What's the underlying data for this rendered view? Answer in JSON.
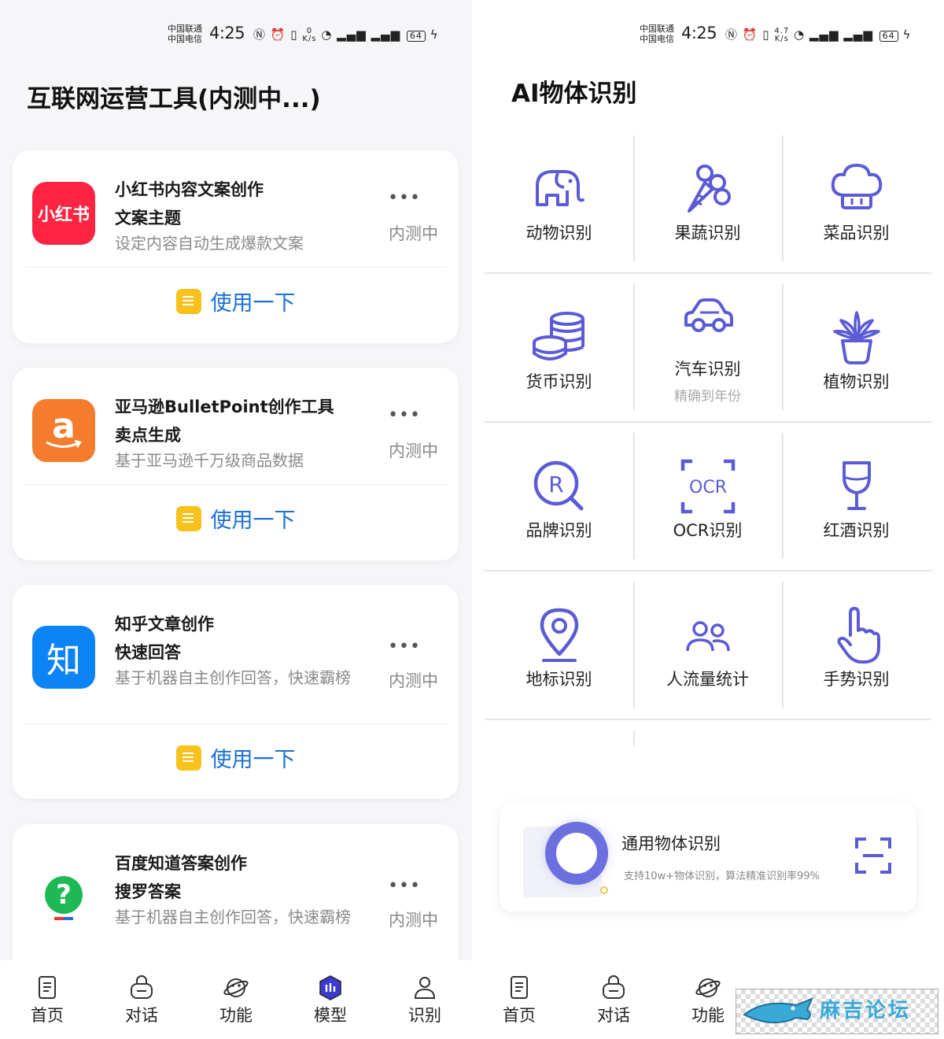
{
  "left": {
    "status": {
      "carrier1": "中国联通",
      "carrier2": "中国电信",
      "time": "4:25",
      "speed_top": "0",
      "speed_unit": "K/s",
      "battery": "64"
    },
    "title": "互联网运营工具(内测中...)",
    "cards": [
      {
        "logo_text": "小红书",
        "title": "小红书内容文案创作",
        "subtitle": "文案主题",
        "desc": "设定内容自动生成爆款文案",
        "menu": "•••",
        "status": "内测中",
        "action": "使用一下"
      },
      {
        "logo_text": "a",
        "title": "亚马逊BulletPoint创作工具",
        "subtitle": "卖点生成",
        "desc": "基于亚马逊千万级商品数据",
        "menu": "•••",
        "status": "内测中",
        "action": "使用一下"
      },
      {
        "logo_text": "知",
        "title": "知乎文章创作",
        "subtitle": "快速回答",
        "desc": "基于机器自主创作回答，快速霸榜",
        "menu": "•••",
        "status": "内测中",
        "action": "使用一下"
      },
      {
        "logo_text": "?",
        "title": "百度知道答案创作",
        "subtitle": "搜罗答案",
        "desc": "基于机器自主创作回答，快速霸榜",
        "menu": "•••",
        "status": "内测中"
      }
    ],
    "nav": [
      {
        "label": "首页",
        "icon": "document-icon"
      },
      {
        "label": "对话",
        "icon": "chat-bag-icon"
      },
      {
        "label": "功能",
        "icon": "planet-icon"
      },
      {
        "label": "模型",
        "icon": "model-icon",
        "active": true
      },
      {
        "label": "识别",
        "icon": "user-icon"
      }
    ]
  },
  "right": {
    "status": {
      "carrier1": "中国联通",
      "carrier2": "中国电信",
      "time": "4:25",
      "speed_top": "4.7",
      "speed_unit": "K/s",
      "battery": "64"
    },
    "title": "AI物体识别",
    "grid": [
      {
        "label": "动物识别",
        "icon": "elephant-icon"
      },
      {
        "label": "果蔬识别",
        "icon": "vegetable-icon"
      },
      {
        "label": "菜品识别",
        "icon": "chef-hat-icon"
      },
      {
        "label": "货币识别",
        "icon": "coins-icon"
      },
      {
        "label": "汽车识别",
        "sub": "精确到年份",
        "icon": "car-icon"
      },
      {
        "label": "植物识别",
        "icon": "potted-plant-icon"
      },
      {
        "label": "品牌识别",
        "icon": "brand-search-icon"
      },
      {
        "label": "OCR识别",
        "icon": "ocr-icon",
        "icon_text": "OCR"
      },
      {
        "label": "红酒识别",
        "icon": "wine-glass-icon"
      },
      {
        "label": "地标识别",
        "icon": "location-pin-icon"
      },
      {
        "label": "人流量统计",
        "icon": "people-icon"
      },
      {
        "label": "手势识别",
        "icon": "hand-icon"
      }
    ],
    "general": {
      "title": "通用物体识别",
      "desc": "支持10w+物体识别，算法精准识别率99%",
      "icon": "scan-icon"
    },
    "nav": [
      {
        "label": "首页",
        "icon": "document-icon"
      },
      {
        "label": "对话",
        "icon": "chat-bag-icon"
      },
      {
        "label": "功能",
        "icon": "planet-icon"
      }
    ],
    "watermark": "麻吉论坛"
  },
  "colors": {
    "accent_blue": "#1a6fd8",
    "icon_indigo": "#5b5bd6",
    "note_yellow": "#f7c21b",
    "xhs_red": "#ff2442",
    "amazon_orange": "#f57c2c",
    "zhihu_blue": "#0c84f6"
  }
}
